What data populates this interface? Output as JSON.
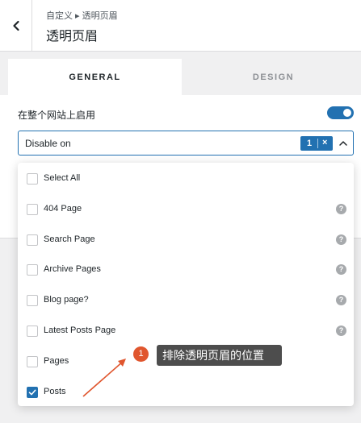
{
  "header": {
    "breadcrumb": "自定义 ▸ 透明页眉",
    "title": "透明页眉"
  },
  "tabs": [
    {
      "label": "GENERAL",
      "active": true
    },
    {
      "label": "DESIGN",
      "active": false
    }
  ],
  "settings": {
    "enable_label": "在整个网站上启用",
    "enable_on": true,
    "select_value": "Disable on",
    "selected_count": "1",
    "remove_glyph": "×"
  },
  "dropdown": {
    "options": [
      {
        "label": "Select All",
        "checked": false,
        "help": false
      },
      {
        "label": "404 Page",
        "checked": false,
        "help": true
      },
      {
        "label": "Search Page",
        "checked": false,
        "help": true
      },
      {
        "label": "Archive Pages",
        "checked": false,
        "help": true
      },
      {
        "label": "Blog page?",
        "checked": false,
        "help": true
      },
      {
        "label": "Latest Posts Page",
        "checked": false,
        "help": true
      },
      {
        "label": "Pages",
        "checked": false,
        "help": false
      },
      {
        "label": "Posts",
        "checked": true,
        "help": false
      }
    ],
    "help_glyph": "?"
  },
  "annotation": {
    "number": "1",
    "text": "排除透明页眉的位置"
  },
  "colors": {
    "accent": "#2271b1",
    "annotation_number": "#e0562e",
    "annotation_box": "#4d4d4d"
  }
}
